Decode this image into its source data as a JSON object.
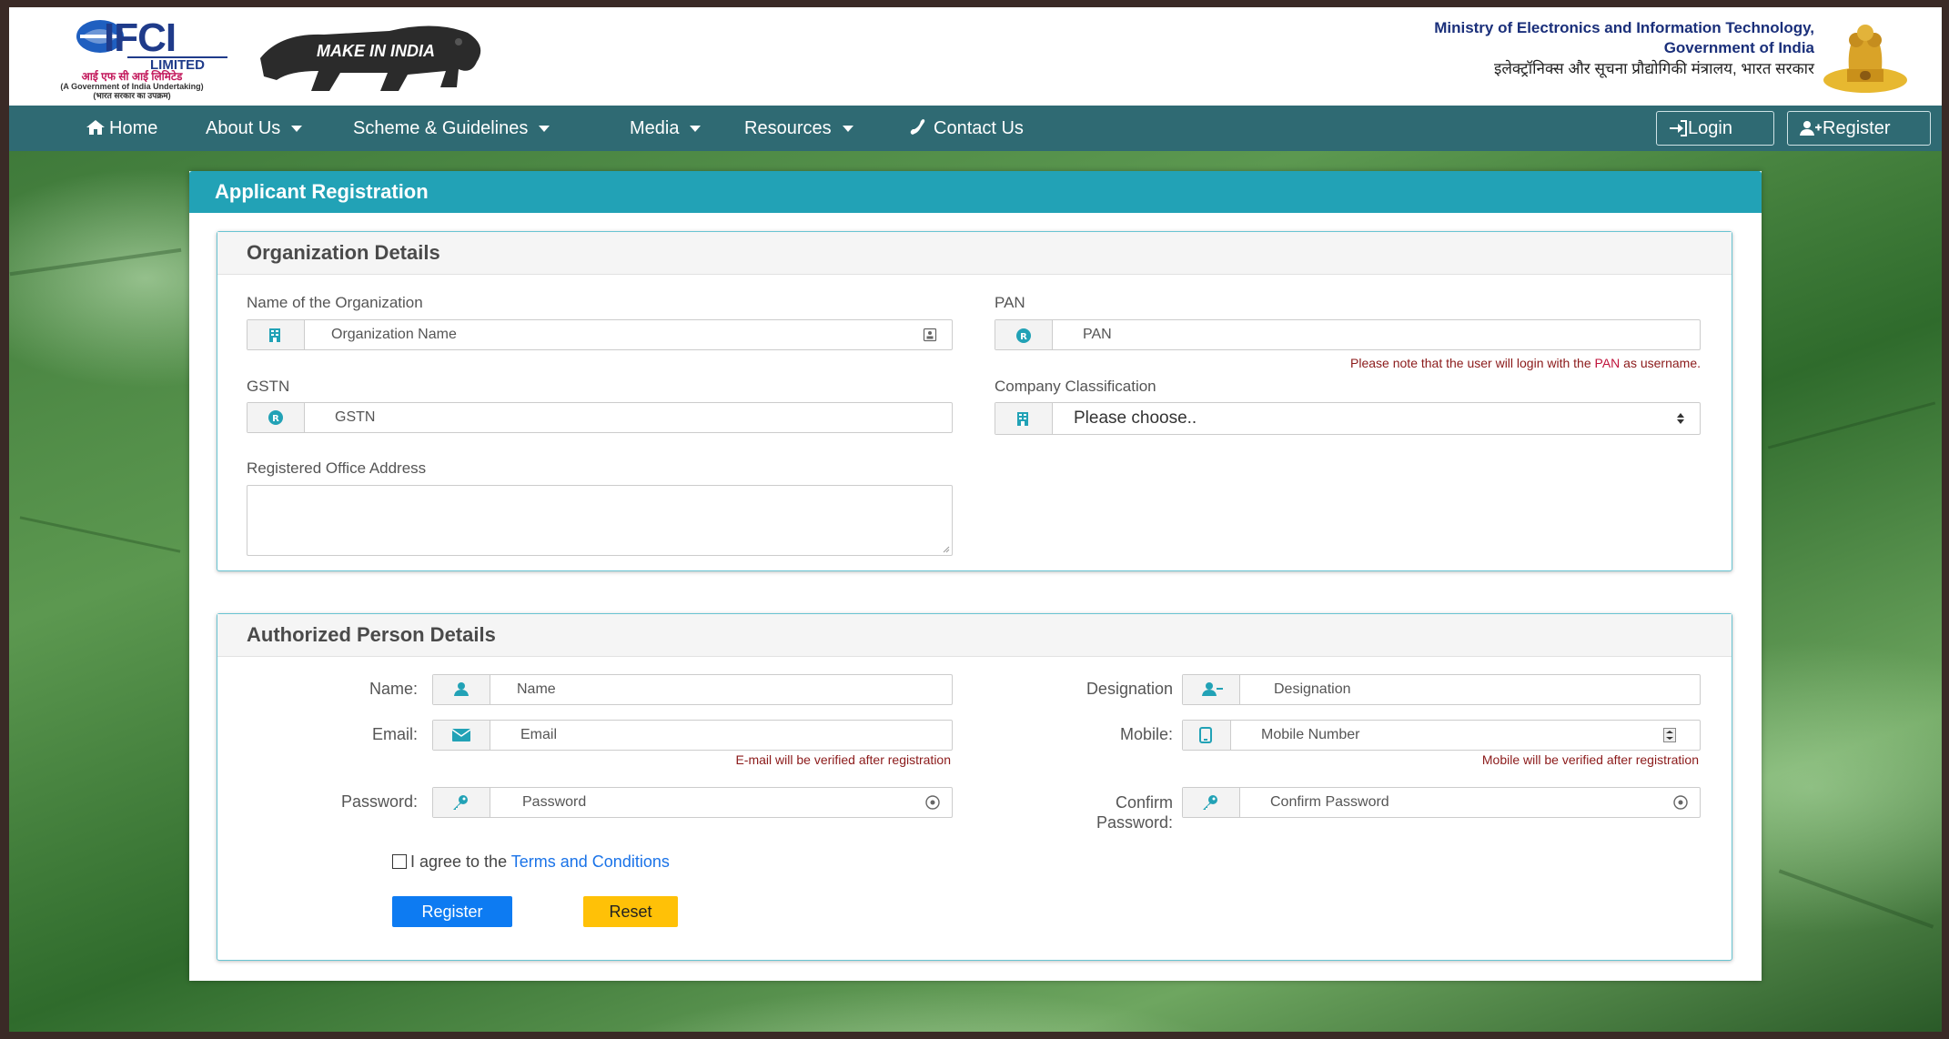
{
  "header": {
    "ifci": {
      "logo_text": "IFCI",
      "limited": "LIMITED",
      "hindi_name": "आई एफ सी आई लिमिटेड",
      "undertaking": "(A Government of India Undertaking)",
      "hindi_undertaking": "(भारत सरकार का उपक्रम)"
    },
    "make_in_india": "MAKE IN INDIA",
    "ministry_line1": "Ministry of Electronics and Information Technology,",
    "ministry_line2": "Government of India",
    "ministry_hindi": "इलेक्ट्रॉनिक्स और सूचना प्रौद्योगिकी मंत्रालय, भारत सरकार"
  },
  "nav": {
    "home": "Home",
    "about": "About Us",
    "scheme": "Scheme & Guidelines",
    "media": "Media",
    "resources": "Resources",
    "contact": "Contact Us",
    "login": "Login",
    "register": "Register"
  },
  "card": {
    "title": "Applicant Registration"
  },
  "org": {
    "title": "Organization Details",
    "name_label": "Name of the Organization",
    "name_placeholder": "Organization Name",
    "pan_label": "PAN",
    "pan_placeholder": "PAN",
    "pan_note_pre": "Please note that the user will login with the ",
    "pan_note_key": "PAN",
    "pan_note_post": " as username.",
    "gstn_label": "GSTN",
    "gstn_placeholder": "GSTN",
    "class_label": "Company Classification",
    "class_value": "Please choose..",
    "address_label": "Registered Office Address"
  },
  "person": {
    "title": "Authorized Person Details",
    "name_label": "Name:",
    "name_placeholder": "Name",
    "designation_label": "Designation",
    "designation_placeholder": "Designation",
    "email_label": "Email:",
    "email_placeholder": "Email",
    "email_note": "E-mail will be verified after registration",
    "mobile_label": "Mobile:",
    "mobile_placeholder": "Mobile Number",
    "mobile_note": "Mobile will be verified after registration",
    "password_label": "Password:",
    "password_placeholder": "Password",
    "confirm_label_1": "Confirm",
    "confirm_label_2": "Password:",
    "confirm_placeholder": "Confirm Password",
    "agree_pre": "I agree to the ",
    "agree_link": "Terms and Conditions",
    "register_btn": "Register",
    "reset_btn": "Reset"
  },
  "colors": {
    "nav_bg": "#2f6a73",
    "card_header": "#22a2b6",
    "panel_border": "#69c4d2",
    "register_btn": "#0d7bf2",
    "reset_btn": "#ffc107",
    "note_text": "#8b1a1a",
    "link": "#1a73e8"
  }
}
